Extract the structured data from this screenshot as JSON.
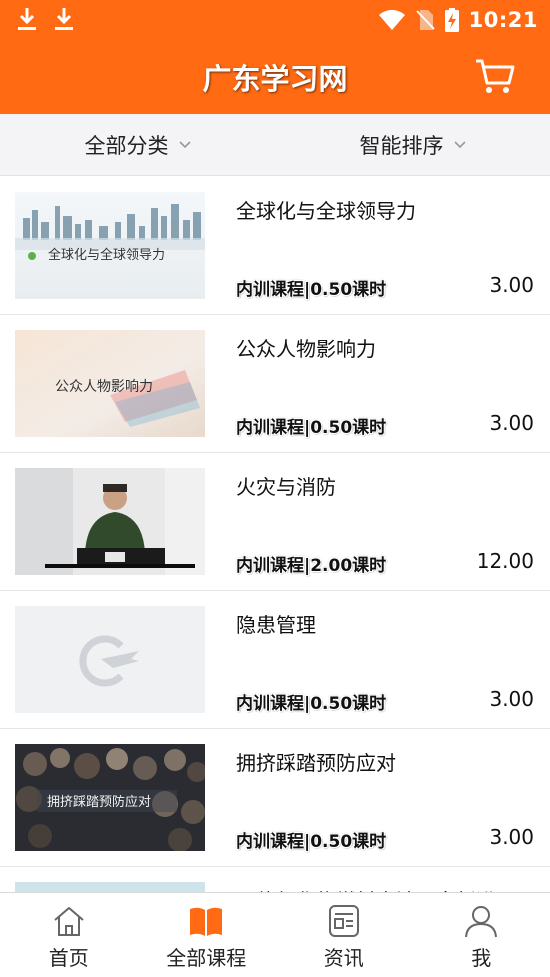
{
  "status_bar": {
    "time": "10:21"
  },
  "header": {
    "title": "广东学习网"
  },
  "filters": {
    "category": {
      "label": "全部分类"
    },
    "sort": {
      "label": "智能排序"
    }
  },
  "courses": [
    {
      "title": "全球化与全球领导力",
      "meta": "内训课程|0.50课时",
      "price": "3.00",
      "thumb_text": "全球化与全球领导力"
    },
    {
      "title": "公众人物影响力",
      "meta": "内训课程|0.50课时",
      "price": "3.00",
      "thumb_text": "公众人物影响力"
    },
    {
      "title": "火灾与消防",
      "meta": "内训课程|2.00课时",
      "price": "12.00"
    },
    {
      "title": "隐患管理",
      "meta": "内训课程|0.50课时",
      "price": "3.00"
    },
    {
      "title": "拥挤踩踏预防应对",
      "meta": "内训课程|0.50课时",
      "price": "3.00",
      "thumb_text": "拥挤踩踏预防应对"
    },
    {
      "title": "固体氧化物燃料电池研究新进展"
    }
  ],
  "bottom_nav": [
    {
      "label": "首页",
      "icon": "home-icon"
    },
    {
      "label": "全部课程",
      "icon": "book-icon",
      "active": true
    },
    {
      "label": "资讯",
      "icon": "news-icon"
    },
    {
      "label": "我",
      "icon": "user-icon"
    }
  ],
  "colors": {
    "brand": "#ff6a13",
    "filter_bg": "#f4f4f6",
    "text": "#111111"
  }
}
